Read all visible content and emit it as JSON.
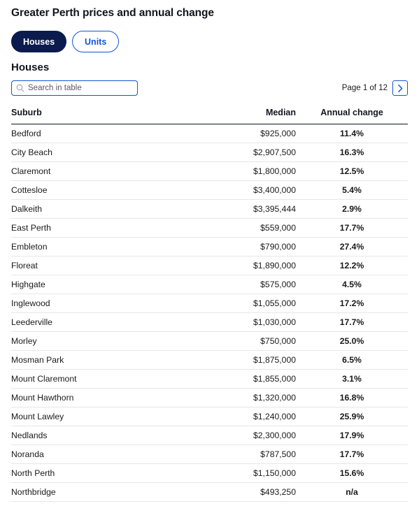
{
  "header": {
    "title": "Greater Perth prices and annual change"
  },
  "toggle": {
    "options": [
      {
        "label": "Houses",
        "active": true
      },
      {
        "label": "Units",
        "active": false
      }
    ]
  },
  "section": {
    "title": "Houses"
  },
  "search": {
    "placeholder": "Search in table",
    "value": "",
    "icon": "search-icon"
  },
  "pagination": {
    "label": "Page 1 of 12",
    "current_page": 1,
    "total_pages": 12,
    "next_icon": "chevron-right-icon"
  },
  "colors": {
    "navy": "#0b1b4d",
    "blue": "#1155d6",
    "text": "#1a1a1a",
    "rule": "#e6e6e6",
    "header_rule": "#11161d"
  },
  "table": {
    "columns": [
      "Suburb",
      "Median",
      "Annual change"
    ],
    "rows": [
      {
        "suburb": "Bedford",
        "median": "$925,000",
        "change": "11.4%"
      },
      {
        "suburb": "City Beach",
        "median": "$2,907,500",
        "change": "16.3%"
      },
      {
        "suburb": "Claremont",
        "median": "$1,800,000",
        "change": "12.5%"
      },
      {
        "suburb": "Cottesloe",
        "median": "$3,400,000",
        "change": "5.4%"
      },
      {
        "suburb": "Dalkeith",
        "median": "$3,395,444",
        "change": "2.9%"
      },
      {
        "suburb": "East Perth",
        "median": "$559,000",
        "change": "17.7%"
      },
      {
        "suburb": "Embleton",
        "median": "$790,000",
        "change": "27.4%"
      },
      {
        "suburb": "Floreat",
        "median": "$1,890,000",
        "change": "12.2%"
      },
      {
        "suburb": "Highgate",
        "median": "$575,000",
        "change": "4.5%"
      },
      {
        "suburb": "Inglewood",
        "median": "$1,055,000",
        "change": "17.2%"
      },
      {
        "suburb": "Leederville",
        "median": "$1,030,000",
        "change": "17.7%"
      },
      {
        "suburb": "Morley",
        "median": "$750,000",
        "change": "25.0%"
      },
      {
        "suburb": "Mosman Park",
        "median": "$1,875,000",
        "change": "6.5%"
      },
      {
        "suburb": "Mount Claremont",
        "median": "$1,855,000",
        "change": "3.1%"
      },
      {
        "suburb": "Mount Hawthorn",
        "median": "$1,320,000",
        "change": "16.8%"
      },
      {
        "suburb": "Mount Lawley",
        "median": "$1,240,000",
        "change": "25.9%"
      },
      {
        "suburb": "Nedlands",
        "median": "$2,300,000",
        "change": "17.9%"
      },
      {
        "suburb": "Noranda",
        "median": "$787,500",
        "change": "17.7%"
      },
      {
        "suburb": "North Perth",
        "median": "$1,150,000",
        "change": "15.6%"
      },
      {
        "suburb": "Northbridge",
        "median": "$493,250",
        "change": "n/a"
      }
    ]
  }
}
